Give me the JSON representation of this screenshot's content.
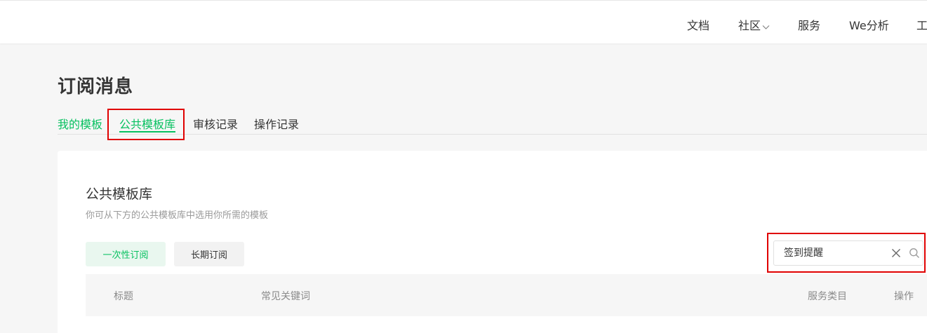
{
  "nav": {
    "items": [
      {
        "label": "文档"
      },
      {
        "label": "社区"
      },
      {
        "label": "服务"
      },
      {
        "label": "We分析"
      },
      {
        "label": "工"
      }
    ]
  },
  "page": {
    "title": "订阅消息"
  },
  "tabs": [
    {
      "label": "我的模板"
    },
    {
      "label": "公共模板库",
      "active": true
    },
    {
      "label": "审核记录"
    },
    {
      "label": "操作记录"
    }
  ],
  "card": {
    "title": "公共模板库",
    "description": "你可从下方的公共模板库中选用你所需的模板",
    "filters": [
      {
        "label": "一次性订阅",
        "active": true
      },
      {
        "label": "长期订阅",
        "active": false
      }
    ],
    "search": {
      "value": "签到提醒"
    },
    "table": {
      "columns": [
        "标题",
        "常见关键词",
        "服务类目",
        "操作"
      ]
    }
  },
  "colors": {
    "accent": "#07c160",
    "highlight": "#e00000"
  }
}
